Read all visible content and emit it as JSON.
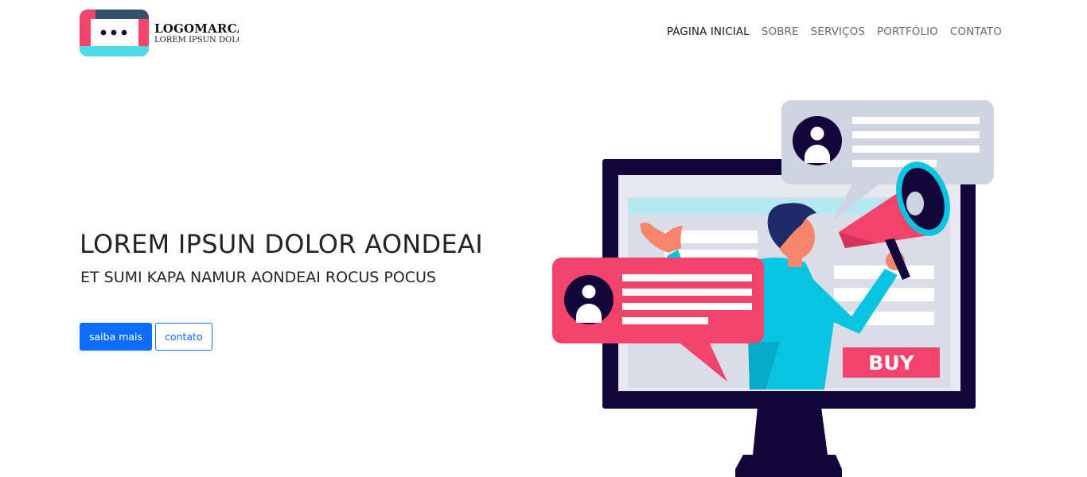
{
  "header": {
    "logo": {
      "title": "LOGOMARCA",
      "subtitle": "LOREM IPSUN DOLOR"
    },
    "nav": [
      {
        "label": "PÁGINA INICIAL",
        "active": true
      },
      {
        "label": "SOBRE",
        "active": false
      },
      {
        "label": "SERVIÇOS",
        "active": false
      },
      {
        "label": "PORTFÓLIO",
        "active": false
      },
      {
        "label": "CONTATO",
        "active": false
      }
    ]
  },
  "hero": {
    "title": "LOREM IPSUN DOLOR AONDEAI",
    "subtitle": "ET SUMI KAPA NAMUR AONDEAI ROCUS POCUS",
    "primary_button": "saiba mais",
    "secondary_button": "contato"
  },
  "illustration": {
    "buy_label": "BUY"
  },
  "colors": {
    "primary": "#0d6efd",
    "accent_pink": "#f4436b",
    "accent_cyan": "#07c4e0",
    "dark_navy": "#12063a",
    "bubble_gray": "#d0d3e0"
  }
}
